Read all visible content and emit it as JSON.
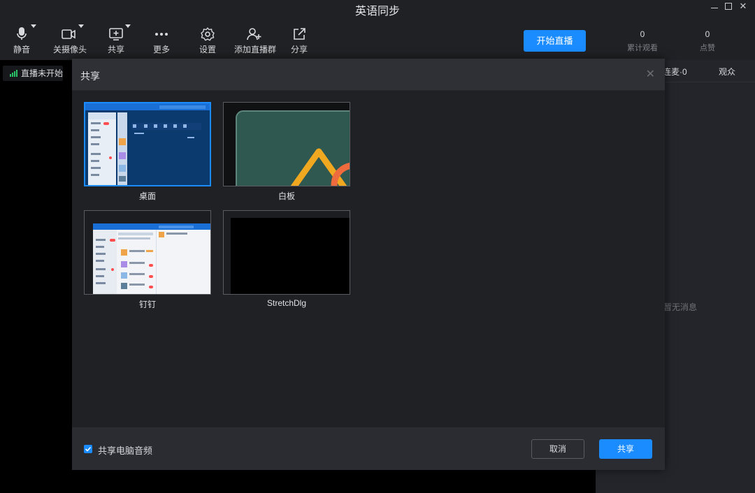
{
  "window": {
    "title": "英语同步"
  },
  "toolbar": {
    "mute_label": "静音",
    "camera_label": "关摄像头",
    "share_label": "共享",
    "more_label": "更多",
    "settings_label": "设置",
    "add_group_label": "添加直播群",
    "forward_label": "分享",
    "start_live_label": "开始直播",
    "stats": [
      {
        "value": "0",
        "label": "累计观看"
      },
      {
        "value": "0",
        "label": "点赞"
      }
    ]
  },
  "left": {
    "status_label": "直播未开始"
  },
  "right": {
    "tabs": [
      "连麦·0",
      "观众"
    ],
    "empty_message": "暂无消息"
  },
  "dialog": {
    "title": "共享",
    "sources": [
      {
        "label": "桌面",
        "selected": true
      },
      {
        "label": "白板",
        "selected": false
      },
      {
        "label": "钉钉",
        "selected": false
      },
      {
        "label": "StretchDlg",
        "selected": false
      }
    ],
    "share_audio_label": "共享电脑音频",
    "share_audio_checked": true,
    "cancel_label": "取消",
    "confirm_label": "共享"
  },
  "colors": {
    "accent": "#1a8cff",
    "signal": "#29c46a",
    "background": "#1e1f22"
  }
}
